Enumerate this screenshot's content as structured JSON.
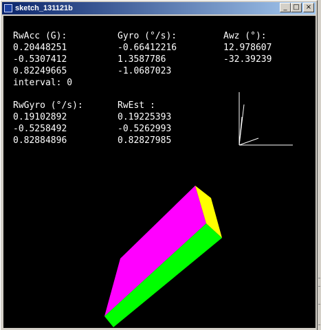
{
  "window": {
    "title": "sketch_131121b",
    "minimize_glyph": "_",
    "maximize_glyph": "□",
    "close_glyph": "×"
  },
  "readouts": {
    "rwacc": {
      "header": "RwAcc (G):",
      "values": [
        "0.20448251",
        "-0.5307412",
        "0.82249665"
      ]
    },
    "gyro": {
      "header": "Gyro (°/s):",
      "values": [
        "-0.66412216",
        "1.3587786",
        "-1.0687023"
      ]
    },
    "awz": {
      "header": "Awz (°):",
      "values": [
        "12.978607",
        "-32.39239"
      ]
    },
    "interval": "interval: 0",
    "rwgyro": {
      "header": "RwGyro (°/s):",
      "values": [
        "0.19102892",
        "-0.5258492",
        "0.82884896"
      ]
    },
    "rwest": {
      "header": "RwEst :",
      "values": [
        "0.19225393",
        "-0.5262993",
        "0.82827985"
      ]
    }
  },
  "colors": {
    "background": "#000000",
    "text": "#ffffff",
    "box_top": "#ff00ff",
    "box_side": "#00ff00",
    "box_end": "#ffff00",
    "axes": "#ffffff"
  }
}
